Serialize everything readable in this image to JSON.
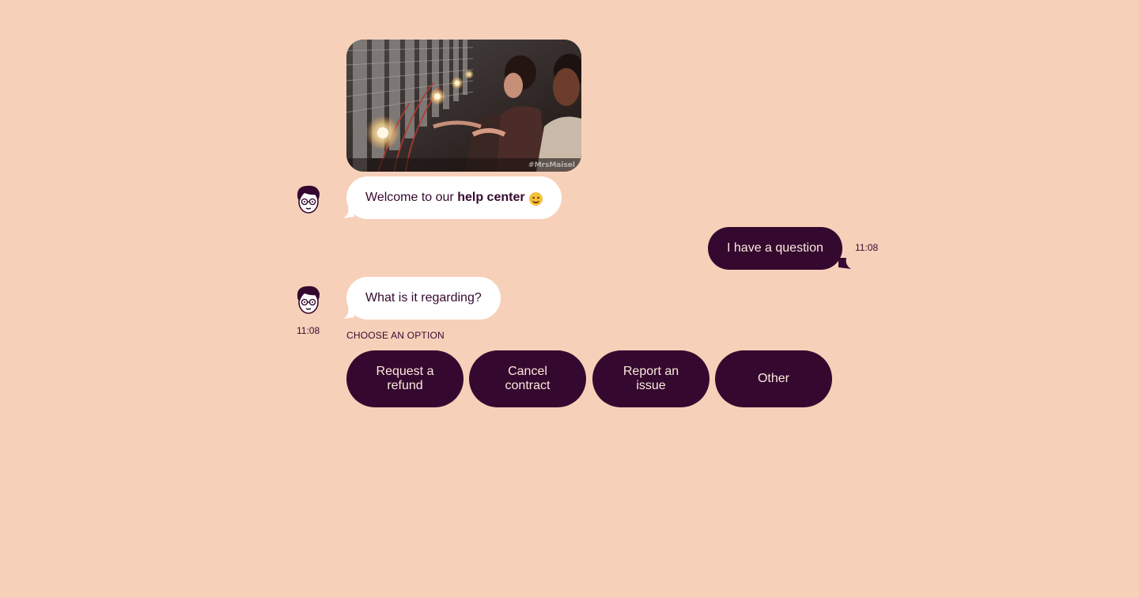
{
  "messages": {
    "gif": {
      "watermark": "#MrsMaisel"
    },
    "welcome": {
      "text_before": "Welcome to our ",
      "text_bold": "help center",
      "emoji": "hugging-face-emoji"
    },
    "user_question": {
      "text": "I have a question",
      "time": "11:08"
    },
    "regarding": {
      "text": "What is it regarding?",
      "time": "11:08"
    }
  },
  "options": {
    "label": "CHOOSE AN OPTION",
    "items": [
      {
        "label": "Request a refund"
      },
      {
        "label": "Cancel contract"
      },
      {
        "label": "Report an issue"
      },
      {
        "label": "Other"
      }
    ]
  },
  "colors": {
    "background": "#f7d0b9",
    "accent": "#35092f",
    "bot_bubble": "#ffffff",
    "user_text": "#fbe9de"
  }
}
